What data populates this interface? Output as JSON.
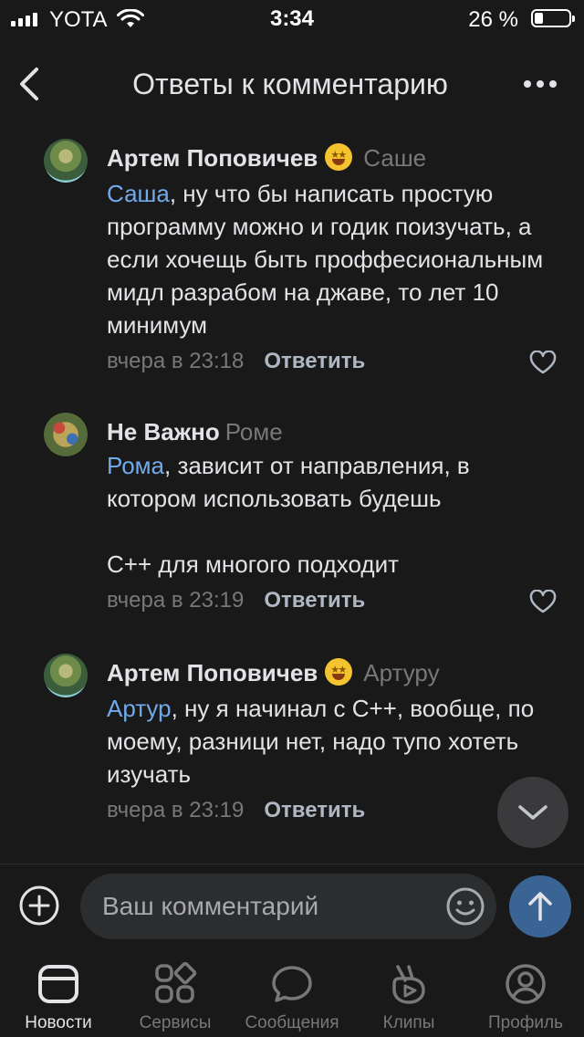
{
  "status_bar": {
    "carrier": "YOTA",
    "time": "3:34",
    "battery": "26 %",
    "battery_level": 0.26
  },
  "header": {
    "title": "Ответы к комментарию"
  },
  "comments": [
    {
      "author": "Артем Поповичев",
      "has_emoji_status": true,
      "reply_to": "Саше",
      "mention": "Саша",
      "text": ", ну что бы написать простую программу можно и годик поизучать, а если хочещь быть проффесиональным мидл разрабом на джаве, то лет 10 минимум",
      "date": "вчера в 23:18",
      "reply_label": "Ответить"
    },
    {
      "author": "Не Важно",
      "has_emoji_status": false,
      "reply_to": "Роме",
      "mention": "Рома",
      "text": ", зависит от направления, в котором использовать будешь",
      "text2": "С++ для многого подходит",
      "date": "вчера в 23:19",
      "reply_label": "Ответить"
    },
    {
      "author": "Артем Поповичев",
      "has_emoji_status": true,
      "reply_to": "Артуру",
      "mention": "Артур",
      "text": ", ну я начинал с С++, вообще, по моему, разници нет, надо тупо хотеть изучать",
      "date": "вчера в 23:19",
      "reply_label": "Ответить"
    }
  ],
  "composer": {
    "placeholder": "Ваш комментарий"
  },
  "tabs": [
    {
      "label": "Новости",
      "icon": "news-icon",
      "active": true
    },
    {
      "label": "Сервисы",
      "icon": "services-icon",
      "active": false
    },
    {
      "label": "Сообщения",
      "icon": "messages-icon",
      "active": false
    },
    {
      "label": "Клипы",
      "icon": "clips-icon",
      "active": false
    },
    {
      "label": "Профиль",
      "icon": "profile-icon",
      "active": false
    }
  ],
  "colors": {
    "background": "#191919",
    "mention": "#71aaeb",
    "secondary": "#76787a",
    "send": "#3a6494"
  }
}
